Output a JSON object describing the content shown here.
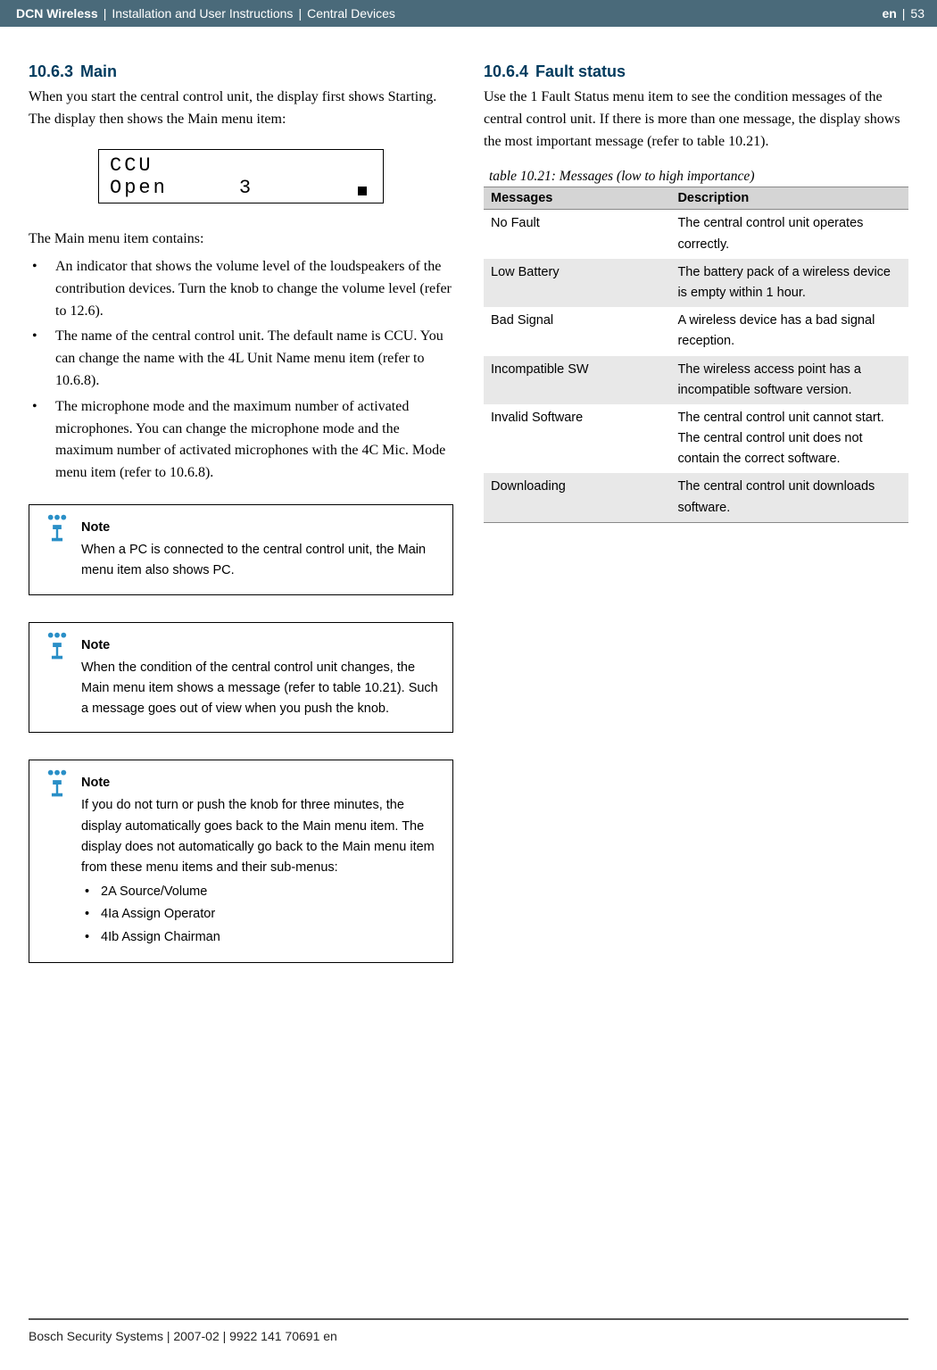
{
  "header": {
    "product": "DCN Wireless",
    "sep": "|",
    "doc": "Installation and User Instructions",
    "section": "Central Devices",
    "lang": "en",
    "page": "53"
  },
  "left": {
    "h_num": "10.6.3",
    "h_title": "Main",
    "intro": "When you start the central control unit, the display first shows Starting. The display then shows the Main menu item:",
    "lcd_line1": "CCU",
    "lcd_line2a": "Open",
    "lcd_line2b": "3",
    "list_intro": "The Main menu item contains:",
    "items": [
      "An indicator that shows the volume level of the loudspeakers of the contribution devices. Turn the knob to change the volume level (refer to 12.6).",
      "The name of the central control unit. The default name is CCU. You can change the name with the 4L Unit Name menu item (refer to 10.6.8).",
      "The microphone mode and the maximum number of activated microphones. You can change the microphone mode and the maximum number of activated microphones with the 4C Mic. Mode menu item (refer to 10.6.8)."
    ],
    "note1_title": "Note",
    "note1_body": "When a PC is connected to the central control unit, the Main menu item also shows PC.",
    "note2_title": "Note",
    "note2_body": "When the condition of the central control unit changes, the Main menu item shows a message (refer to table 10.21). Such a message goes out of view when you push the knob.",
    "note3_title": "Note",
    "note3_body": "If you do not turn or push the knob for three minutes, the display automatically goes back to the Main menu item. The display does not automatically go back to the Main menu item from these menu items and their sub-menus:",
    "note3_items": [
      "2A Source/Volume",
      "4Ia Assign Operator",
      "4Ib Assign Chairman"
    ]
  },
  "right": {
    "h_num": "10.6.4",
    "h_title": "Fault status",
    "intro": "Use the 1 Fault Status menu item to see the condition messages of the central control unit. If there is more than one message, the display shows the most important message (refer to table 10.21).",
    "table_caption": "table 10.21: Messages (low to high importance)",
    "col1": "Messages",
    "col2": "Description",
    "rows": [
      {
        "m": "No Fault",
        "d": "The central control unit operates correctly."
      },
      {
        "m": "Low Battery",
        "d": "The battery pack of a wireless device is empty within 1 hour."
      },
      {
        "m": "Bad Signal",
        "d": "A wireless device has a bad signal reception."
      },
      {
        "m": "Incompatible SW",
        "d": "The wireless access point has a incompatible software version."
      },
      {
        "m": "Invalid Software",
        "d": "The central control unit cannot start. The central control unit does not contain the correct software."
      },
      {
        "m": "Downloading",
        "d": "The central control unit downloads software."
      }
    ]
  },
  "footer": "Bosch Security Systems | 2007-02 | 9922 141 70691 en"
}
